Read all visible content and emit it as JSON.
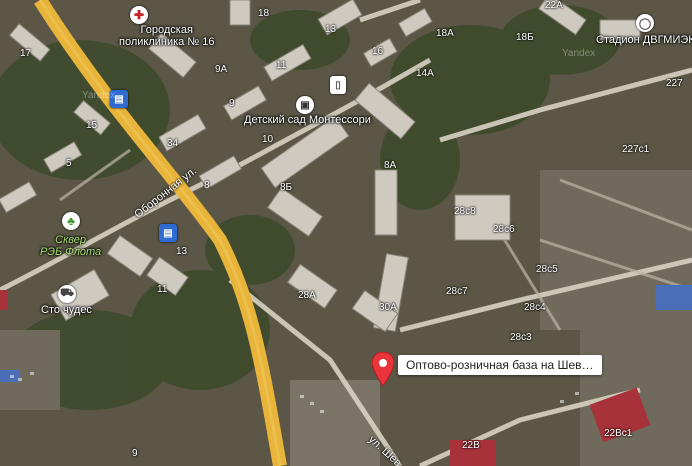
{
  "map": {
    "poi": {
      "polyclinic": {
        "line1": "Городская",
        "line2": "поликлиника № 16"
      },
      "kindergarten": "Детский сад Монтессори",
      "stadium": "Стадион ДВГМИЭК",
      "square": {
        "line1": "Сквер",
        "line2": "РЭБ Флота"
      },
      "sto": "Сто чудес"
    },
    "streets": {
      "oboronnaya": "Оборонная ул.",
      "shev": "ул. Шев"
    },
    "popup": "Оптово-розничная база на Шев…",
    "watermark": "Yandex",
    "house_numbers": [
      "17",
      "18",
      "13",
      "16",
      "18А",
      "18Б",
      "22А",
      "9А",
      "11",
      "14А",
      "15",
      "9",
      "34",
      "10",
      "8А",
      "5",
      "8Б",
      "8",
      "227",
      "227с1",
      "28с8",
      "28с6",
      "13",
      "11",
      "28с5",
      "28с7",
      "28А",
      "30А",
      "28с4",
      "28с3",
      "22Вс1",
      "22В",
      "9",
      "19"
    ],
    "icons": {
      "polyclinic": "medical-cross-icon",
      "kindergarten": "kindergarten-icon",
      "stadium": "stadium-icon",
      "bus1": "bus-stop-icon",
      "bus2": "bus-stop-icon",
      "square": "tree-icon",
      "sto": "car-service-icon",
      "pin": "location-pin-icon",
      "building": "building-icon"
    },
    "colors": {
      "road_main": "#e8b53a",
      "road_secondary": "#d8d2c2",
      "pin": "#e8343a",
      "square_label": "#a8e070"
    }
  }
}
